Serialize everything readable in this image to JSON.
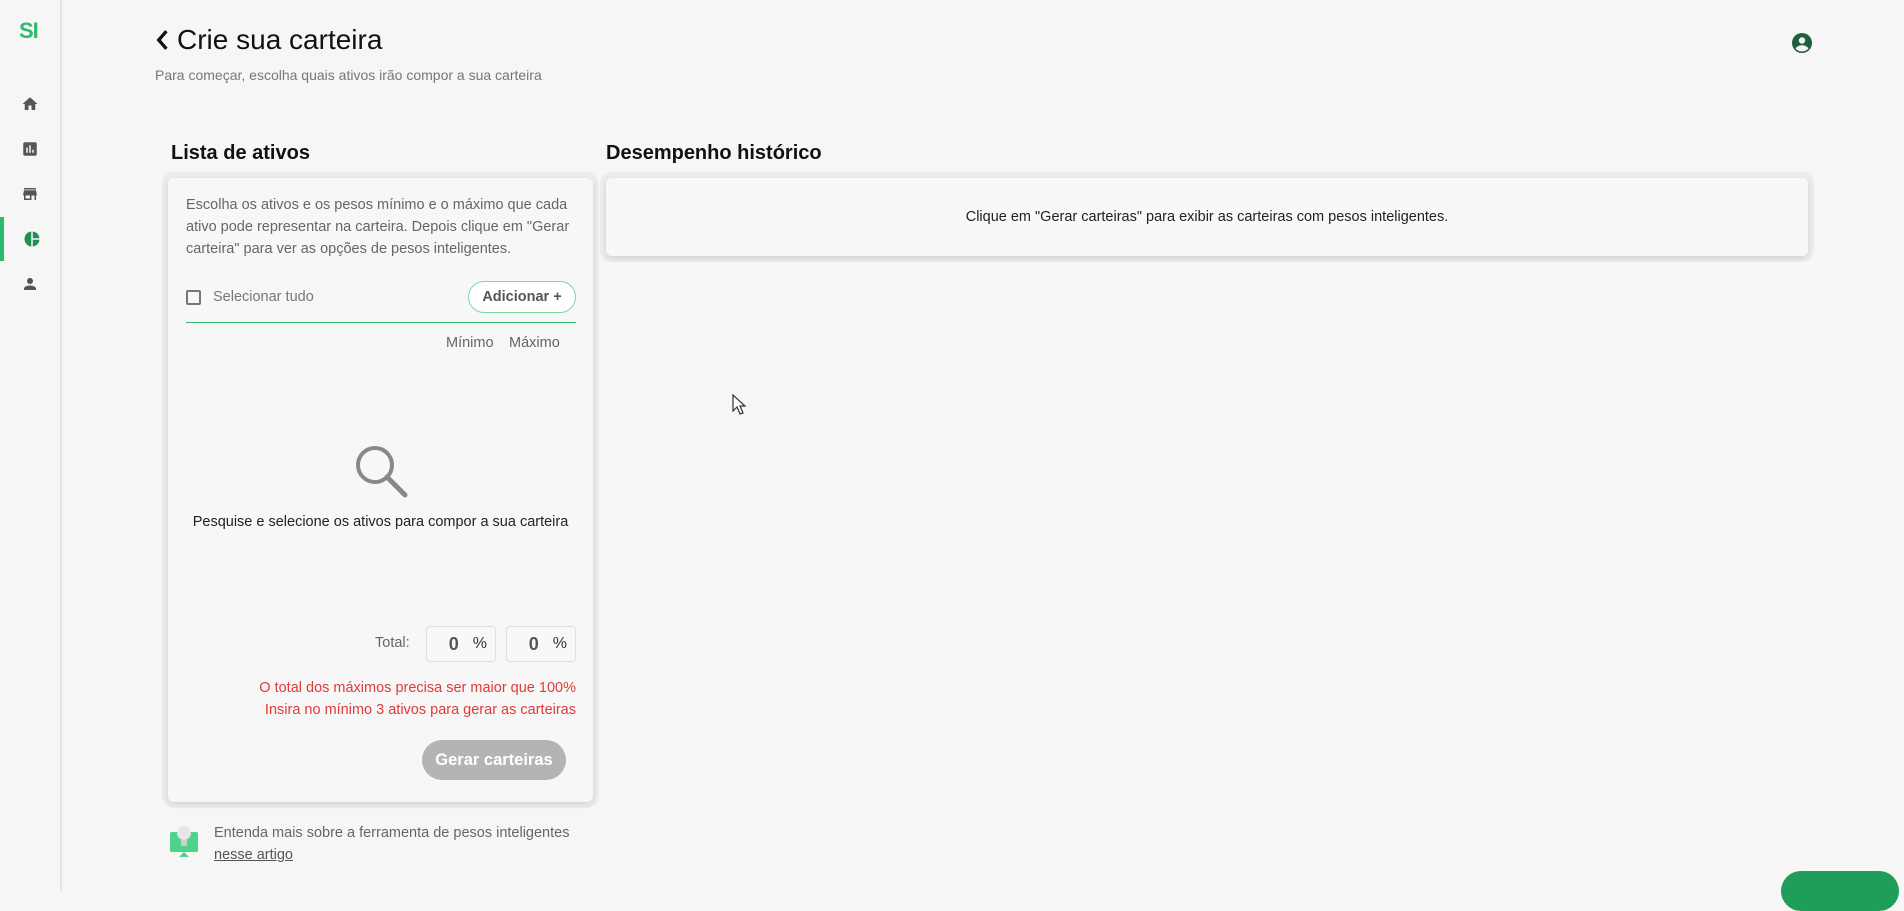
{
  "sidebar": {
    "logo": "SI",
    "items": [
      {
        "icon": "home-icon"
      },
      {
        "icon": "chart-icon"
      },
      {
        "icon": "store-icon"
      },
      {
        "icon": "pie-chart-icon",
        "active": true
      },
      {
        "icon": "person-icon"
      }
    ]
  },
  "header": {
    "title": "Crie sua carteira",
    "subtitle": "Para começar, escolha quais ativos irão compor a sua carteira"
  },
  "assets": {
    "section_title": "Lista de ativos",
    "description": "Escolha os ativos e os pesos mínimo e o máximo que cada ativo pode representar na carteira. Depois clique em \"Gerar carteira\" para ver as opções de pesos inteligentes.",
    "select_all_label": "Selecionar tudo",
    "add_button_label": "Adicionar +",
    "col_min": "Mínimo",
    "col_max": "Máximo",
    "empty_text": "Pesquise e selecione os ativos para compor a sua carteira",
    "total_label": "Total:",
    "total_min": "0",
    "total_max": "0",
    "percent_symbol": "%",
    "error_max": "O total dos máximos precisa ser maior que 100%",
    "error_min_assets": "Insira no mínimo 3 ativos para gerar as carteiras",
    "generate_button_label": "Gerar carteiras"
  },
  "info": {
    "text": "Entenda mais sobre a ferramenta de pesos inteligentes",
    "link": "nesse artigo"
  },
  "performance": {
    "section_title": "Desempenho histórico",
    "placeholder": "Clique em \"Gerar carteiras\" para exibir as carteiras com pesos inteligentes."
  },
  "colors": {
    "accent": "#2eb872",
    "error": "#e03a3a",
    "disabled": "#b4b4b4"
  }
}
